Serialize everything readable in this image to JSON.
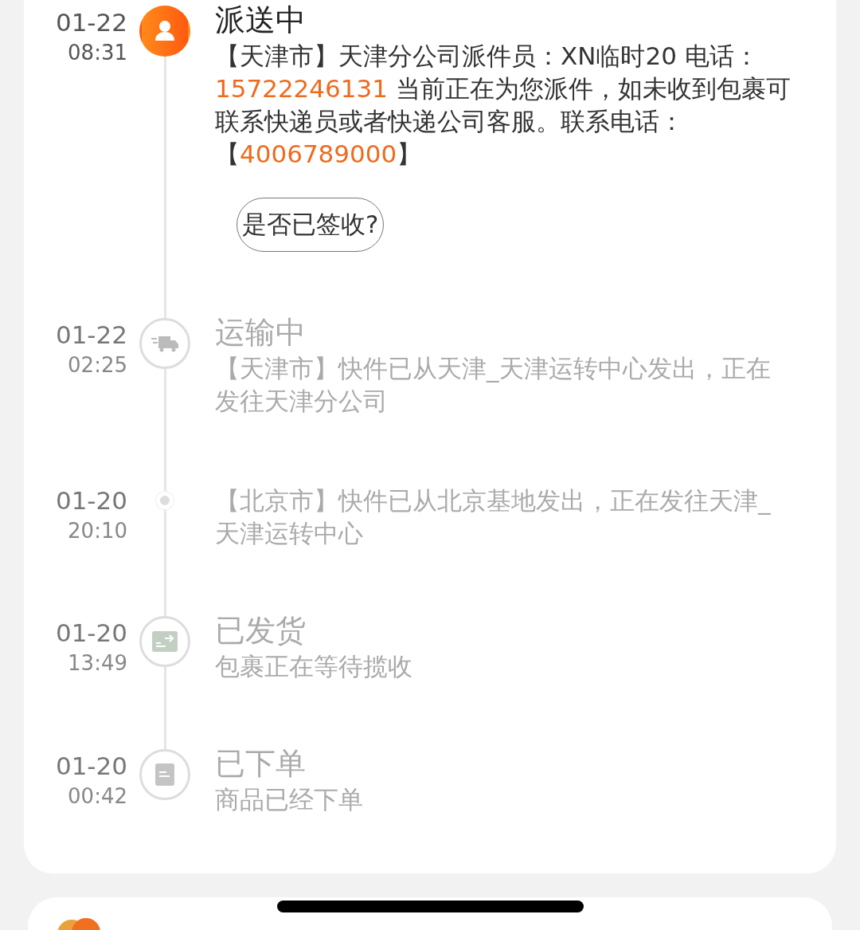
{
  "events": [
    {
      "date": "01-22",
      "time": "08:31",
      "kind": "delivering",
      "active": true,
      "title": "派送中",
      "body": [
        {
          "text": "【天津市】天津分公司派件员：XN临时20 电话：",
          "highlight": false
        },
        {
          "text": "15722246131",
          "highlight": true
        },
        {
          "text": " 当前正在为您派件，如未收到包裹可联系快递员或者快递公司客服。联系电话：【",
          "highlight": false
        },
        {
          "text": "4006789000",
          "highlight": true
        },
        {
          "text": "】",
          "highlight": false
        }
      ],
      "action": "是否已签收?"
    },
    {
      "date": "01-22",
      "time": "02:25",
      "kind": "transit",
      "active": false,
      "title": "运输中",
      "body": [
        {
          "text": "【天津市】快件已从天津_天津运转中心发出，正在发往天津分公司",
          "highlight": false
        }
      ]
    },
    {
      "date": "01-20",
      "time": "20:10",
      "kind": "step",
      "active": false,
      "body": [
        {
          "text": "【北京市】快件已从北京基地发出，正在发往天津_天津运转中心",
          "highlight": false
        }
      ]
    },
    {
      "date": "01-20",
      "time": "13:49",
      "kind": "shipped",
      "active": false,
      "title": "已发货",
      "body": [
        {
          "text": "包裹正在等待揽收",
          "highlight": false
        }
      ]
    },
    {
      "date": "01-20",
      "time": "00:42",
      "kind": "ordered",
      "active": false,
      "title": "已下单",
      "body": [
        {
          "text": "商品已经下单",
          "highlight": false
        }
      ]
    }
  ]
}
